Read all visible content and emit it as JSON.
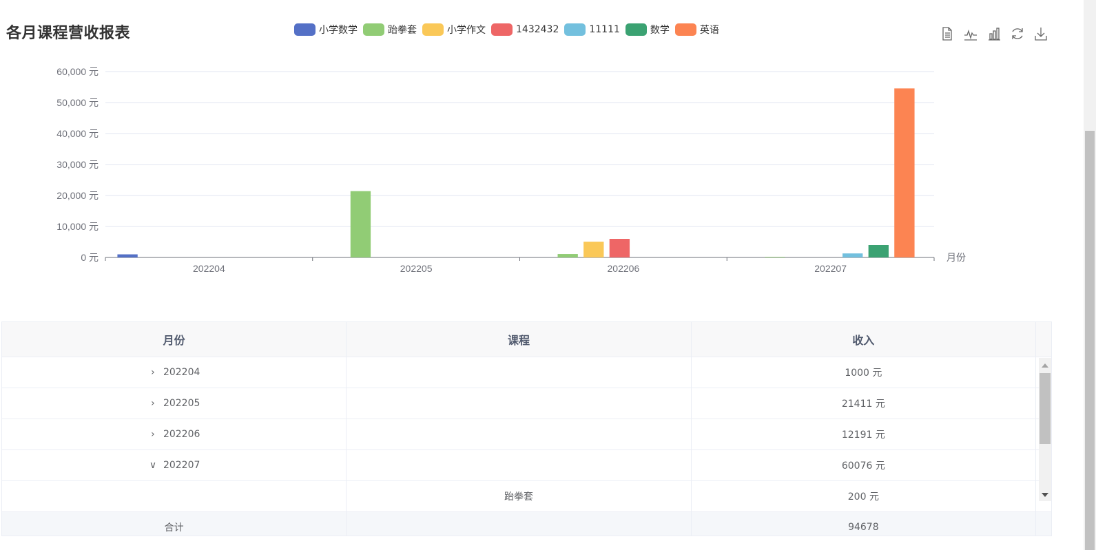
{
  "title": "各月课程营收报表",
  "legend": [
    {
      "name": "小学数学",
      "color": "#5470c6"
    },
    {
      "name": "跆拳套",
      "color": "#91cc75"
    },
    {
      "name": "小学作文",
      "color": "#fac858"
    },
    {
      "name": "1432432",
      "color": "#ee6666"
    },
    {
      "name": "11111",
      "color": "#73c0de"
    },
    {
      "name": "数学",
      "color": "#3ba272"
    },
    {
      "name": "英语",
      "color": "#fc8452"
    }
  ],
  "toolbox": [
    {
      "name": "data-view-icon"
    },
    {
      "name": "line-chart-icon"
    },
    {
      "name": "bar-chart-icon"
    },
    {
      "name": "refresh-icon"
    },
    {
      "name": "download-icon"
    }
  ],
  "chart_data": {
    "type": "bar",
    "categories": [
      "202204",
      "202205",
      "202206",
      "202207"
    ],
    "xlabel": "月份",
    "ylabel": "",
    "ylim": [
      0,
      60000
    ],
    "yticks": [
      "0 元",
      "10,000 元",
      "20,000 元",
      "30,000 元",
      "40,000 元",
      "50,000 元",
      "60,000 元"
    ],
    "grid": true,
    "series": [
      {
        "name": "小学数学",
        "color": "#5470c6",
        "values": [
          1000,
          0,
          0,
          0
        ]
      },
      {
        "name": "跆拳套",
        "color": "#91cc75",
        "values": [
          0,
          21411,
          1100,
          200
        ]
      },
      {
        "name": "小学作文",
        "color": "#fac858",
        "values": [
          0,
          0,
          5091,
          0
        ]
      },
      {
        "name": "1432432",
        "color": "#ee6666",
        "values": [
          0,
          0,
          6000,
          0
        ]
      },
      {
        "name": "11111",
        "color": "#73c0de",
        "values": [
          0,
          0,
          0,
          1300
        ]
      },
      {
        "name": "数学",
        "color": "#3ba272",
        "values": [
          0,
          0,
          0,
          4000
        ]
      },
      {
        "name": "英语",
        "color": "#fc8452",
        "values": [
          0,
          0,
          0,
          54576
        ]
      }
    ]
  },
  "table": {
    "headers": [
      "月份",
      "课程",
      "收入"
    ],
    "rows": [
      {
        "month": "202204",
        "course": "",
        "income": "1000 元",
        "expanded": false,
        "child": false
      },
      {
        "month": "202205",
        "course": "",
        "income": "21411 元",
        "expanded": false,
        "child": false
      },
      {
        "month": "202206",
        "course": "",
        "income": "12191 元",
        "expanded": false,
        "child": false
      },
      {
        "month": "202207",
        "course": "",
        "income": "60076 元",
        "expanded": true,
        "child": false
      },
      {
        "month": "",
        "course": "跆拳套",
        "income": "200 元",
        "expanded": false,
        "child": true
      }
    ],
    "footer": {
      "label": "合计",
      "course": "",
      "total": "94678"
    }
  }
}
